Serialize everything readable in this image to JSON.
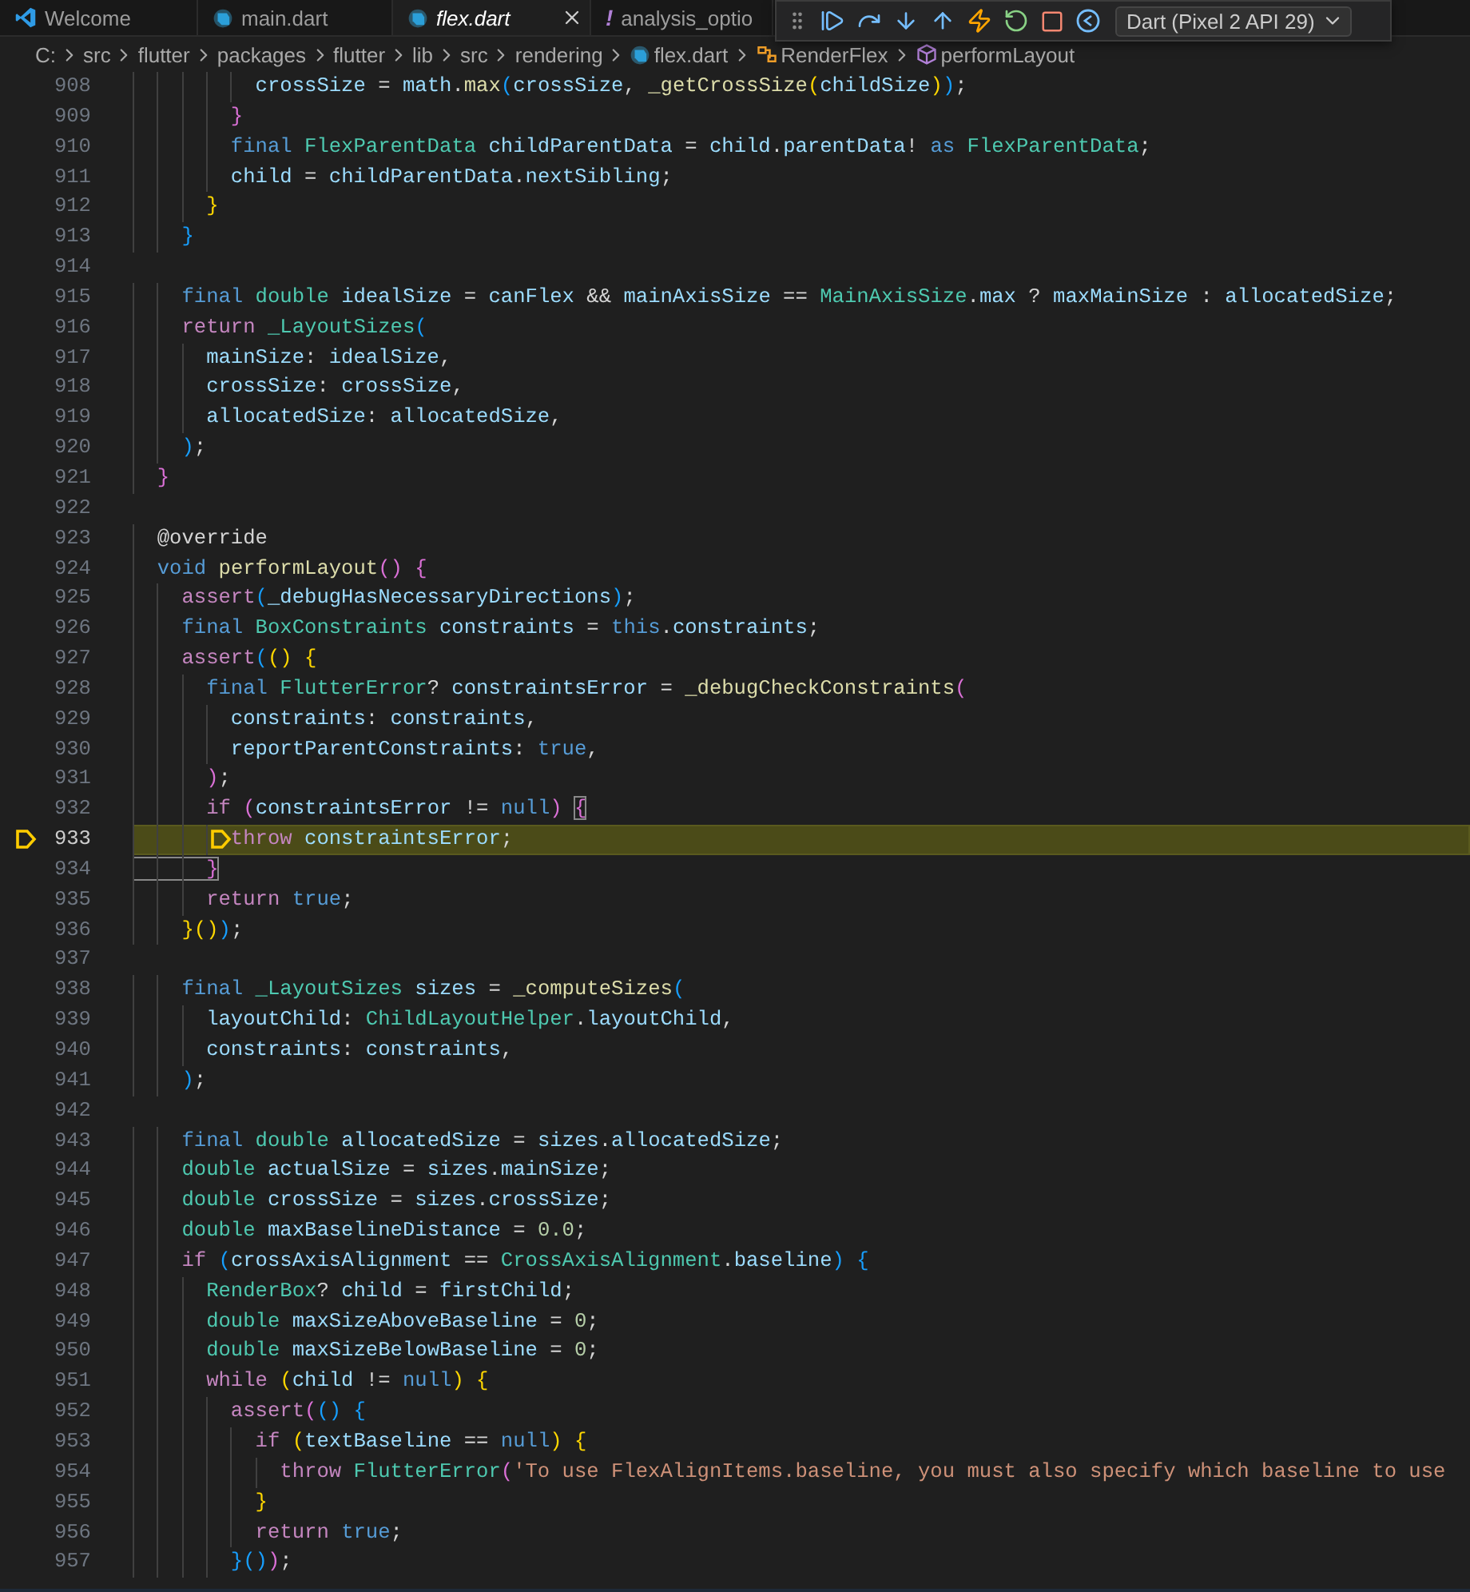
{
  "tabs": [
    {
      "label": "Welcome",
      "kind": "vscode",
      "selected": false,
      "preview": false
    },
    {
      "label": "main.dart",
      "kind": "dart",
      "selected": false,
      "preview": false
    },
    {
      "label": "flex.dart",
      "kind": "dart",
      "selected": true,
      "preview": true
    },
    {
      "label": "analysis_optio",
      "kind": "yaml",
      "glyph": "!",
      "selected": false,
      "preview": false
    }
  ],
  "debug_toolbar": {
    "device": "Dart (Pixel 2 API 29)"
  },
  "breadcrumb": [
    {
      "label": "C:",
      "kind": "folder"
    },
    {
      "label": "src",
      "kind": "folder"
    },
    {
      "label": "flutter",
      "kind": "folder"
    },
    {
      "label": "packages",
      "kind": "folder"
    },
    {
      "label": "flutter",
      "kind": "folder"
    },
    {
      "label": "lib",
      "kind": "folder"
    },
    {
      "label": "src",
      "kind": "folder"
    },
    {
      "label": "rendering",
      "kind": "folder"
    },
    {
      "label": "flex.dart",
      "kind": "file"
    },
    {
      "label": "RenderFlex",
      "kind": "class"
    },
    {
      "label": "performLayout",
      "kind": "method"
    }
  ],
  "editor": {
    "lines": [
      {
        "number": "908",
        "current": false,
        "tokens": [
          {
            "text": "          crossSize",
            "kind": "var"
          },
          {
            "text": " = ",
            "kind": "plain"
          },
          {
            "text": "math",
            "kind": "var"
          },
          {
            "text": ".",
            "kind": "plain"
          },
          {
            "text": "max",
            "kind": "fn"
          },
          {
            "text": "(",
            "kind": "b3"
          },
          {
            "text": "crossSize",
            "kind": "var"
          },
          {
            "text": ", ",
            "kind": "plain"
          },
          {
            "text": "_getCrossSize",
            "kind": "fn"
          },
          {
            "text": "(",
            "kind": "b1"
          },
          {
            "text": "childSize",
            "kind": "var"
          },
          {
            "text": ")",
            "kind": "b1"
          },
          {
            "text": ")",
            "kind": "b3"
          },
          {
            "text": ";",
            "kind": "plain"
          }
        ]
      },
      {
        "number": "909",
        "current": false,
        "tokens": [
          {
            "text": "        }",
            "kind": "b2"
          }
        ]
      },
      {
        "number": "910",
        "current": false,
        "tokens": [
          {
            "text": "        final ",
            "kind": "kw"
          },
          {
            "text": "FlexParentData ",
            "kind": "type"
          },
          {
            "text": "childParentData",
            "kind": "var"
          },
          {
            "text": " = ",
            "kind": "plain"
          },
          {
            "text": "child",
            "kind": "var"
          },
          {
            "text": ".",
            "kind": "plain"
          },
          {
            "text": "parentData",
            "kind": "var"
          },
          {
            "text": "! ",
            "kind": "plain"
          },
          {
            "text": "as ",
            "kind": "kw"
          },
          {
            "text": "FlexParentData",
            "kind": "type"
          },
          {
            "text": ";",
            "kind": "plain"
          }
        ]
      },
      {
        "number": "911",
        "current": false,
        "tokens": [
          {
            "text": "        child",
            "kind": "var"
          },
          {
            "text": " = ",
            "kind": "plain"
          },
          {
            "text": "childParentData",
            "kind": "var"
          },
          {
            "text": ".",
            "kind": "plain"
          },
          {
            "text": "nextSibling",
            "kind": "var"
          },
          {
            "text": ";",
            "kind": "plain"
          }
        ]
      },
      {
        "number": "912",
        "current": false,
        "tokens": [
          {
            "text": "      }",
            "kind": "b1"
          }
        ]
      },
      {
        "number": "913",
        "current": false,
        "tokens": [
          {
            "text": "    }",
            "kind": "b3"
          }
        ]
      },
      {
        "number": "914",
        "current": false
      },
      {
        "number": "915",
        "current": false,
        "tokens": [
          {
            "text": "    final ",
            "kind": "kw"
          },
          {
            "text": "double ",
            "kind": "type"
          },
          {
            "text": "idealSize",
            "kind": "var"
          },
          {
            "text": " = ",
            "kind": "plain"
          },
          {
            "text": "canFlex",
            "kind": "var"
          },
          {
            "text": " && ",
            "kind": "plain"
          },
          {
            "text": "mainAxisSize",
            "kind": "var"
          },
          {
            "text": " == ",
            "kind": "plain"
          },
          {
            "text": "MainAxisSize",
            "kind": "type"
          },
          {
            "text": ".",
            "kind": "plain"
          },
          {
            "text": "max",
            "kind": "var"
          },
          {
            "text": " ? ",
            "kind": "plain"
          },
          {
            "text": "maxMainSize",
            "kind": "var"
          },
          {
            "text": " : ",
            "kind": "plain"
          },
          {
            "text": "allocatedSize",
            "kind": "var"
          },
          {
            "text": ";",
            "kind": "plain"
          }
        ]
      },
      {
        "number": "916",
        "current": false,
        "tokens": [
          {
            "text": "    return ",
            "kind": "ctrl"
          },
          {
            "text": "_LayoutSizes",
            "kind": "type"
          },
          {
            "text": "(",
            "kind": "b3"
          }
        ]
      },
      {
        "number": "917",
        "current": false,
        "tokens": [
          {
            "text": "      mainSize",
            "kind": "var"
          },
          {
            "text": ": ",
            "kind": "plain"
          },
          {
            "text": "idealSize",
            "kind": "var"
          },
          {
            "text": ",",
            "kind": "plain"
          }
        ]
      },
      {
        "number": "918",
        "current": false,
        "tokens": [
          {
            "text": "      crossSize",
            "kind": "var"
          },
          {
            "text": ": ",
            "kind": "plain"
          },
          {
            "text": "crossSize",
            "kind": "var"
          },
          {
            "text": ",",
            "kind": "plain"
          }
        ]
      },
      {
        "number": "919",
        "current": false,
        "tokens": [
          {
            "text": "      allocatedSize",
            "kind": "var"
          },
          {
            "text": ": ",
            "kind": "plain"
          },
          {
            "text": "allocatedSize",
            "kind": "var"
          },
          {
            "text": ",",
            "kind": "plain"
          }
        ]
      },
      {
        "number": "920",
        "current": false,
        "tokens": [
          {
            "text": "    )",
            "kind": "b3"
          },
          {
            "text": ";",
            "kind": "plain"
          }
        ]
      },
      {
        "number": "921",
        "current": false,
        "tokens": [
          {
            "text": "  }",
            "kind": "b2"
          }
        ]
      },
      {
        "number": "922",
        "current": false
      },
      {
        "number": "923",
        "current": false,
        "tokens": [
          {
            "text": "  @override",
            "kind": "plain"
          }
        ]
      },
      {
        "number": "924",
        "current": false,
        "tokens": [
          {
            "text": "  void ",
            "kind": "kw"
          },
          {
            "text": "performLayout",
            "kind": "fn"
          },
          {
            "text": "() {",
            "kind": "b2"
          }
        ]
      },
      {
        "number": "925",
        "current": false,
        "tokens": [
          {
            "text": "    assert",
            "kind": "ctrl"
          },
          {
            "text": "(",
            "kind": "b3"
          },
          {
            "text": "_debugHasNecessaryDirections",
            "kind": "var"
          },
          {
            "text": ")",
            "kind": "b3"
          },
          {
            "text": ";",
            "kind": "plain"
          }
        ]
      },
      {
        "number": "926",
        "current": false,
        "tokens": [
          {
            "text": "    final ",
            "kind": "kw"
          },
          {
            "text": "BoxConstraints ",
            "kind": "type"
          },
          {
            "text": "constraints",
            "kind": "var"
          },
          {
            "text": " = ",
            "kind": "plain"
          },
          {
            "text": "this",
            "kind": "kw"
          },
          {
            "text": ".",
            "kind": "plain"
          },
          {
            "text": "constraints",
            "kind": "var"
          },
          {
            "text": ";",
            "kind": "plain"
          }
        ]
      },
      {
        "number": "927",
        "current": false,
        "tokens": [
          {
            "text": "    assert",
            "kind": "ctrl"
          },
          {
            "text": "(",
            "kind": "b3"
          },
          {
            "text": "() {",
            "kind": "b1"
          }
        ]
      },
      {
        "number": "928",
        "current": false,
        "tokens": [
          {
            "text": "      final ",
            "kind": "kw"
          },
          {
            "text": "FlutterError",
            "kind": "type"
          },
          {
            "text": "? ",
            "kind": "plain"
          },
          {
            "text": "constraintsError",
            "kind": "var"
          },
          {
            "text": " = ",
            "kind": "plain"
          },
          {
            "text": "_debugCheckConstraints",
            "kind": "fn"
          },
          {
            "text": "(",
            "kind": "b2"
          }
        ]
      },
      {
        "number": "929",
        "current": false,
        "tokens": [
          {
            "text": "        constraints",
            "kind": "var"
          },
          {
            "text": ": ",
            "kind": "plain"
          },
          {
            "text": "constraints",
            "kind": "var"
          },
          {
            "text": ",",
            "kind": "plain"
          }
        ]
      },
      {
        "number": "930",
        "current": false,
        "tokens": [
          {
            "text": "        reportParentConstraints",
            "kind": "var"
          },
          {
            "text": ": ",
            "kind": "plain"
          },
          {
            "text": "true",
            "kind": "kw"
          },
          {
            "text": ",",
            "kind": "plain"
          }
        ]
      },
      {
        "number": "931",
        "current": false,
        "tokens": [
          {
            "text": "      )",
            "kind": "b2"
          },
          {
            "text": ";",
            "kind": "plain"
          }
        ]
      },
      {
        "number": "932",
        "current": false,
        "tokens": [
          {
            "text": "      if ",
            "kind": "ctrl"
          },
          {
            "text": "(",
            "kind": "b2"
          },
          {
            "text": "constraintsError",
            "kind": "var"
          },
          {
            "text": " != ",
            "kind": "plain"
          },
          {
            "text": "null",
            "kind": "kw"
          },
          {
            "text": ") ",
            "kind": "b2"
          },
          {
            "text": "{",
            "kind": "match"
          }
        ]
      },
      {
        "number": "933",
        "current": true,
        "tokens": [
          {
            "text": "        throw ",
            "kind": "ctrl"
          },
          {
            "text": "constraintsError",
            "kind": "var"
          },
          {
            "text": ";",
            "kind": "plain"
          }
        ]
      },
      {
        "number": "934",
        "current": false,
        "tokens": [
          {
            "text": "      }",
            "kind": "match"
          }
        ]
      },
      {
        "number": "935",
        "current": false,
        "tokens": [
          {
            "text": "      return ",
            "kind": "ctrl"
          },
          {
            "text": "true",
            "kind": "kw"
          },
          {
            "text": ";",
            "kind": "plain"
          }
        ]
      },
      {
        "number": "936",
        "current": false,
        "tokens": [
          {
            "text": "    }()",
            "kind": "b1"
          },
          {
            "text": ")",
            "kind": "b3"
          },
          {
            "text": ";",
            "kind": "plain"
          }
        ]
      },
      {
        "number": "937",
        "current": false
      },
      {
        "number": "938",
        "current": false,
        "tokens": [
          {
            "text": "    final ",
            "kind": "kw"
          },
          {
            "text": "_LayoutSizes ",
            "kind": "type"
          },
          {
            "text": "sizes",
            "kind": "var"
          },
          {
            "text": " = ",
            "kind": "plain"
          },
          {
            "text": "_computeSizes",
            "kind": "fn"
          },
          {
            "text": "(",
            "kind": "b3"
          }
        ]
      },
      {
        "number": "939",
        "current": false,
        "tokens": [
          {
            "text": "      layoutChild",
            "kind": "var"
          },
          {
            "text": ": ",
            "kind": "plain"
          },
          {
            "text": "ChildLayoutHelper",
            "kind": "type"
          },
          {
            "text": ".",
            "kind": "plain"
          },
          {
            "text": "layoutChild",
            "kind": "var"
          },
          {
            "text": ",",
            "kind": "plain"
          }
        ]
      },
      {
        "number": "940",
        "current": false,
        "tokens": [
          {
            "text": "      constraints",
            "kind": "var"
          },
          {
            "text": ": ",
            "kind": "plain"
          },
          {
            "text": "constraints",
            "kind": "var"
          },
          {
            "text": ",",
            "kind": "plain"
          }
        ]
      },
      {
        "number": "941",
        "current": false,
        "tokens": [
          {
            "text": "    )",
            "kind": "b3"
          },
          {
            "text": ";",
            "kind": "plain"
          }
        ]
      },
      {
        "number": "942",
        "current": false
      },
      {
        "number": "943",
        "current": false,
        "tokens": [
          {
            "text": "    final ",
            "kind": "kw"
          },
          {
            "text": "double ",
            "kind": "type"
          },
          {
            "text": "allocatedSize",
            "kind": "var"
          },
          {
            "text": " = ",
            "kind": "plain"
          },
          {
            "text": "sizes",
            "kind": "var"
          },
          {
            "text": ".",
            "kind": "plain"
          },
          {
            "text": "allocatedSize",
            "kind": "var"
          },
          {
            "text": ";",
            "kind": "plain"
          }
        ]
      },
      {
        "number": "944",
        "current": false,
        "tokens": [
          {
            "text": "    double ",
            "kind": "type"
          },
          {
            "text": "actualSize",
            "kind": "var"
          },
          {
            "text": " = ",
            "kind": "plain"
          },
          {
            "text": "sizes",
            "kind": "var"
          },
          {
            "text": ".",
            "kind": "plain"
          },
          {
            "text": "mainSize",
            "kind": "var"
          },
          {
            "text": ";",
            "kind": "plain"
          }
        ]
      },
      {
        "number": "945",
        "current": false,
        "tokens": [
          {
            "text": "    double ",
            "kind": "type"
          },
          {
            "text": "crossSize",
            "kind": "var"
          },
          {
            "text": " = ",
            "kind": "plain"
          },
          {
            "text": "sizes",
            "kind": "var"
          },
          {
            "text": ".",
            "kind": "plain"
          },
          {
            "text": "crossSize",
            "kind": "var"
          },
          {
            "text": ";",
            "kind": "plain"
          }
        ]
      },
      {
        "number": "946",
        "current": false,
        "tokens": [
          {
            "text": "    double ",
            "kind": "type"
          },
          {
            "text": "maxBaselineDistance",
            "kind": "var"
          },
          {
            "text": " = ",
            "kind": "plain"
          },
          {
            "text": "0.0",
            "kind": "num"
          },
          {
            "text": ";",
            "kind": "plain"
          }
        ]
      },
      {
        "number": "947",
        "current": false,
        "tokens": [
          {
            "text": "    if ",
            "kind": "ctrl"
          },
          {
            "text": "(",
            "kind": "b3"
          },
          {
            "text": "crossAxisAlignment",
            "kind": "var"
          },
          {
            "text": " == ",
            "kind": "plain"
          },
          {
            "text": "CrossAxisAlignment",
            "kind": "type"
          },
          {
            "text": ".",
            "kind": "plain"
          },
          {
            "text": "baseline",
            "kind": "var"
          },
          {
            "text": ") {",
            "kind": "b3"
          }
        ]
      },
      {
        "number": "948",
        "current": false,
        "tokens": [
          {
            "text": "      RenderBox",
            "kind": "type"
          },
          {
            "text": "? ",
            "kind": "plain"
          },
          {
            "text": "child",
            "kind": "var"
          },
          {
            "text": " = ",
            "kind": "plain"
          },
          {
            "text": "firstChild",
            "kind": "var"
          },
          {
            "text": ";",
            "kind": "plain"
          }
        ]
      },
      {
        "number": "949",
        "current": false,
        "tokens": [
          {
            "text": "      double ",
            "kind": "type"
          },
          {
            "text": "maxSizeAboveBaseline",
            "kind": "var"
          },
          {
            "text": " = ",
            "kind": "plain"
          },
          {
            "text": "0",
            "kind": "num"
          },
          {
            "text": ";",
            "kind": "plain"
          }
        ]
      },
      {
        "number": "950",
        "current": false,
        "tokens": [
          {
            "text": "      double ",
            "kind": "type"
          },
          {
            "text": "maxSizeBelowBaseline",
            "kind": "var"
          },
          {
            "text": " = ",
            "kind": "plain"
          },
          {
            "text": "0",
            "kind": "num"
          },
          {
            "text": ";",
            "kind": "plain"
          }
        ]
      },
      {
        "number": "951",
        "current": false,
        "tokens": [
          {
            "text": "      while ",
            "kind": "ctrl"
          },
          {
            "text": "(",
            "kind": "b1"
          },
          {
            "text": "child",
            "kind": "var"
          },
          {
            "text": " != ",
            "kind": "plain"
          },
          {
            "text": "null",
            "kind": "kw"
          },
          {
            "text": ") {",
            "kind": "b1"
          }
        ]
      },
      {
        "number": "952",
        "current": false,
        "tokens": [
          {
            "text": "        assert",
            "kind": "ctrl"
          },
          {
            "text": "(",
            "kind": "b2"
          },
          {
            "text": "() {",
            "kind": "b3"
          }
        ]
      },
      {
        "number": "953",
        "current": false,
        "tokens": [
          {
            "text": "          if ",
            "kind": "ctrl"
          },
          {
            "text": "(",
            "kind": "b1"
          },
          {
            "text": "textBaseline",
            "kind": "var"
          },
          {
            "text": " == ",
            "kind": "plain"
          },
          {
            "text": "null",
            "kind": "kw"
          },
          {
            "text": ") {",
            "kind": "b1"
          }
        ]
      },
      {
        "number": "954",
        "current": false,
        "tokens": [
          {
            "text": "            throw ",
            "kind": "ctrl"
          },
          {
            "text": "FlutterError",
            "kind": "type"
          },
          {
            "text": "(",
            "kind": "b2"
          },
          {
            "text": "'To use FlexAlignItems.baseline, you must also specify which baseline to use",
            "kind": "str"
          }
        ]
      },
      {
        "number": "955",
        "current": false,
        "tokens": [
          {
            "text": "          }",
            "kind": "b1"
          }
        ]
      },
      {
        "number": "956",
        "current": false,
        "tokens": [
          {
            "text": "          return ",
            "kind": "ctrl"
          },
          {
            "text": "true",
            "kind": "kw"
          },
          {
            "text": ";",
            "kind": "plain"
          }
        ]
      },
      {
        "number": "957",
        "current": false,
        "tokens": [
          {
            "text": "        }()",
            "kind": "b3"
          },
          {
            "text": ")",
            "kind": "b2"
          },
          {
            "text": ";",
            "kind": "plain"
          }
        ]
      }
    ]
  }
}
